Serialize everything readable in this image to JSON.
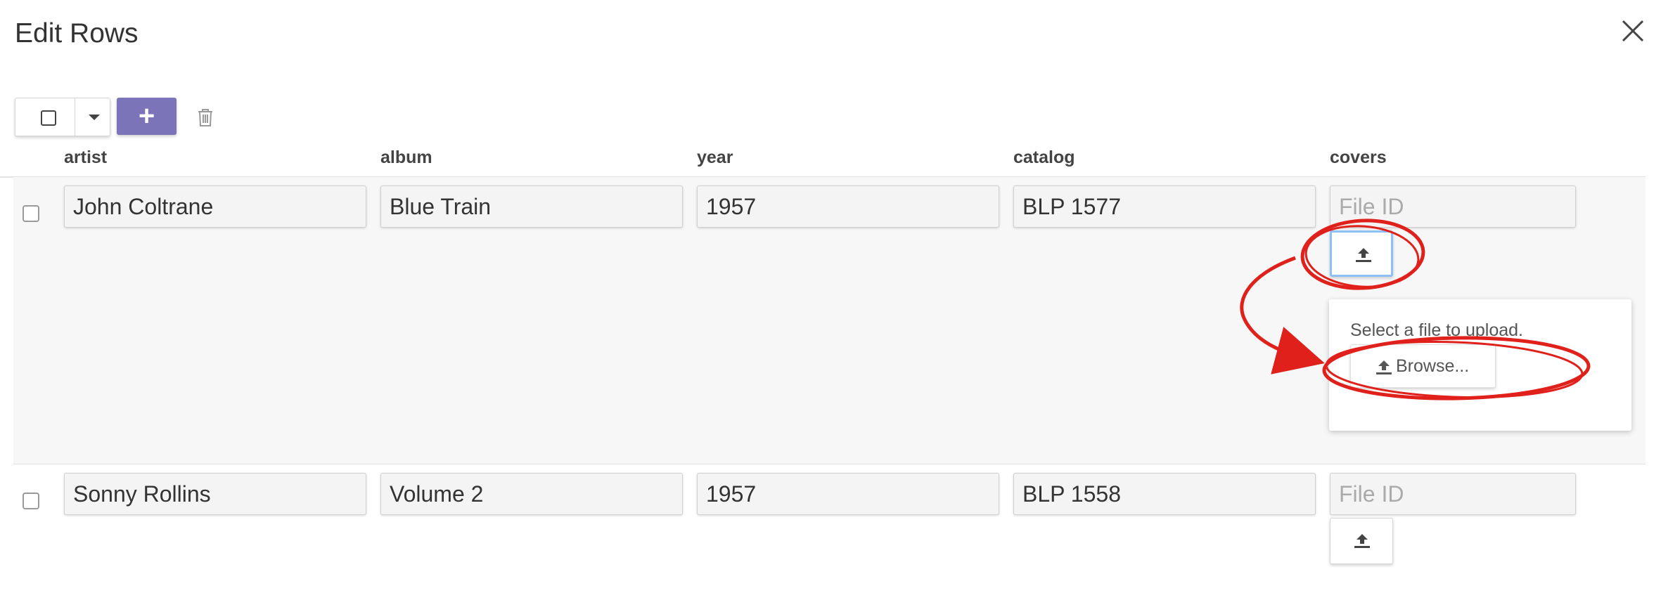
{
  "dialog": {
    "title": "Edit Rows"
  },
  "icons": {
    "close": "close-icon",
    "select_checkbox": "checkbox-icon",
    "select_menu": "caret-down-icon",
    "add": "plus-icon",
    "delete": "trash-icon",
    "upload": "upload-icon"
  },
  "toolbar": {
    "add_label": "+"
  },
  "columns": [
    "artist",
    "album",
    "year",
    "catalog",
    "covers"
  ],
  "rows": [
    {
      "artist": "John Coltrane",
      "album": "Blue Train",
      "year": "1957",
      "catalog": "BLP 1577",
      "covers_placeholder": "File ID"
    },
    {
      "artist": "Sonny Rollins",
      "album": "Volume 2",
      "year": "1957",
      "catalog": "BLP 1558",
      "covers_placeholder": "File ID"
    }
  ],
  "upload_popup": {
    "message": "Select a file to upload.",
    "browse_label": "Browse..."
  },
  "colors": {
    "accent": "#7b74b8",
    "annotation": "#e0201b",
    "focus": "#8fc0f5"
  }
}
